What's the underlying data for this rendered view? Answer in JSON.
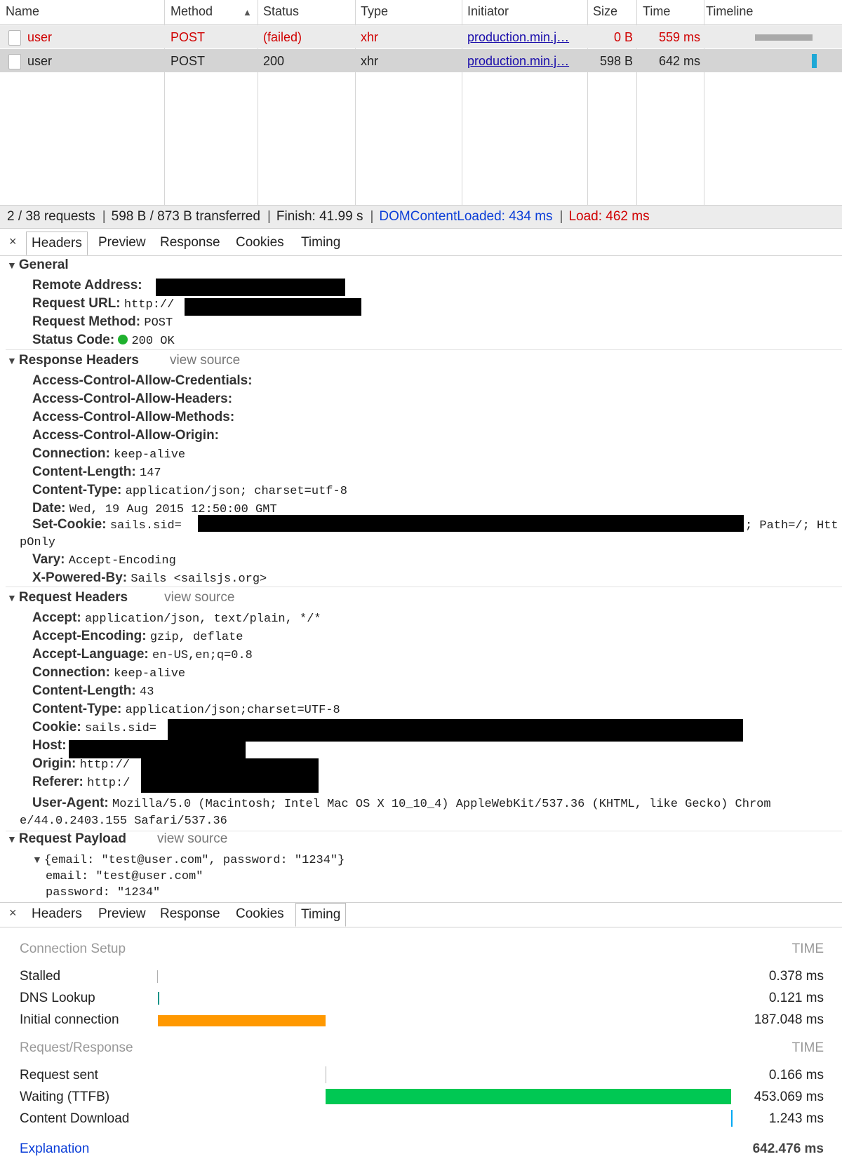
{
  "network": {
    "columns": [
      "Name",
      "Method",
      "Status",
      "Type",
      "Initiator",
      "Size",
      "Time",
      "Timeline"
    ],
    "sort_indicator": "▲",
    "rows": [
      {
        "name": "user",
        "method": "POST",
        "status": "(failed)",
        "type": "xhr",
        "initiator": "production.min.j…",
        "size": "0 B",
        "time": "559 ms",
        "failed": true
      },
      {
        "name": "user",
        "method": "POST",
        "status": "200",
        "type": "xhr",
        "initiator": "production.min.j…",
        "size": "598 B",
        "time": "642 ms",
        "failed": false
      }
    ],
    "summary": {
      "requests": "2 / 38 requests",
      "transferred": "598 B / 873 B transferred",
      "finish": "Finish: 41.99 s",
      "dom": "DOMContentLoaded: 434 ms",
      "load": "Load: 462 ms"
    }
  },
  "tabs": {
    "close": "×",
    "items": [
      "Headers",
      "Preview",
      "Response",
      "Cookies",
      "Timing"
    ]
  },
  "general": {
    "title": "General",
    "remote_address_key": "Remote Address:",
    "request_url_key": "Request URL:",
    "request_url_val": "http://",
    "method_key": "Request Method:",
    "method_val": "POST",
    "status_key": "Status Code:",
    "status_val": "200 OK"
  },
  "response_headers": {
    "title": "Response Headers",
    "view_source": "view source",
    "acac": "Access-Control-Allow-Credentials:",
    "acah": "Access-Control-Allow-Headers:",
    "acam": "Access-Control-Allow-Methods:",
    "acao": "Access-Control-Allow-Origin:",
    "connection_key": "Connection:",
    "connection_val": "keep-alive",
    "length_key": "Content-Length:",
    "length_val": "147",
    "ctype_key": "Content-Type:",
    "ctype_val": "application/json; charset=utf-8",
    "date_key": "Date:",
    "date_val": "Wed, 19 Aug 2015 12:50:00 GMT",
    "cookie_key": "Set-Cookie:",
    "cookie_val": "sails.sid=",
    "cookie_tail": "; Path=/; Htt",
    "cookie_wrap": "pOnly",
    "vary_key": "Vary:",
    "vary_val": "Accept-Encoding",
    "powered_key": "X-Powered-By:",
    "powered_val": "Sails <sailsjs.org>"
  },
  "request_headers": {
    "title": "Request Headers",
    "view_source": "view source",
    "accept_key": "Accept:",
    "accept_val": "application/json, text/plain, */*",
    "enc_key": "Accept-Encoding:",
    "enc_val": "gzip, deflate",
    "lang_key": "Accept-Language:",
    "lang_val": "en-US,en;q=0.8",
    "conn_key": "Connection:",
    "conn_val": "keep-alive",
    "len_key": "Content-Length:",
    "len_val": "43",
    "ctype_key": "Content-Type:",
    "ctype_val": "application/json;charset=UTF-8",
    "cookie_key": "Cookie:",
    "cookie_val": "sails.sid=",
    "host_key": "Host:",
    "origin_key": "Origin:",
    "origin_val": "http://",
    "referer_key": "Referer:",
    "referer_val": "http:/",
    "ua_key": "User-Agent:",
    "ua_val": "Mozilla/5.0 (Macintosh; Intel Mac OS X 10_10_4) AppleWebKit/537.36 (KHTML, like Gecko) Chrom",
    "ua_wrap": "e/44.0.2403.155 Safari/537.36"
  },
  "payload": {
    "title": "Request Payload",
    "view_source": "view source",
    "summary": "{email: \"test@user.com\", password: \"1234\"}",
    "email_key": "email",
    "email_val": "\"test@user.com\"",
    "password_key": "password",
    "password_val": "\"1234\""
  },
  "timing": {
    "setup_title": "Connection Setup",
    "time_header": "TIME",
    "stalled": "Stalled",
    "stalled_val": "0.378 ms",
    "dns": "DNS Lookup",
    "dns_val": "0.121 ms",
    "initial": "Initial connection",
    "initial_val": "187.048 ms",
    "rr_title": "Request/Response",
    "sent": "Request sent",
    "sent_val": "0.166 ms",
    "waiting": "Waiting (TTFB)",
    "waiting_val": "453.069 ms",
    "download": "Content Download",
    "download_val": "1.243 ms",
    "explanation": "Explanation",
    "total": "642.476 ms"
  },
  "colors": {
    "initial_connection": "#ff9800",
    "waiting": "#00c853",
    "content_download": "#03a9f4",
    "failed_text": "#d00000",
    "link": "#1a0dab"
  }
}
